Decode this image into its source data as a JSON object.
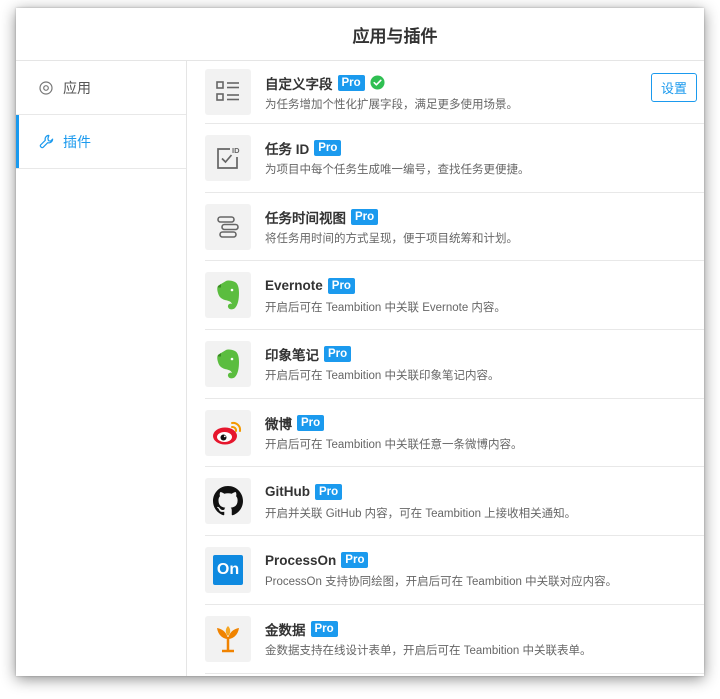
{
  "header": {
    "title": "应用与插件"
  },
  "sidebar": {
    "items": [
      {
        "label": "应用",
        "icon": "target-icon"
      },
      {
        "label": "插件",
        "icon": "wrench-icon"
      }
    ]
  },
  "colors": {
    "accent": "#1b9aee",
    "check": "#2fbf52",
    "evernote": "#5bbd3f"
  },
  "plugins": [
    {
      "name": "自定义字段",
      "badge": "Pro",
      "installed": true,
      "description": "为任务增加个性化扩展字段，满足更多使用场景。",
      "action_label": "设置",
      "icon": "custom-fields-icon"
    },
    {
      "name": "任务 ID",
      "badge": "Pro",
      "description": "为项目中每个任务生成唯一编号，查找任务更便捷。",
      "icon": "task-id-icon"
    },
    {
      "name": "任务时间视图",
      "badge": "Pro",
      "description": "将任务用时间的方式呈现，便于项目统筹和计划。",
      "icon": "timeline-icon"
    },
    {
      "name": "Evernote",
      "badge": "Pro",
      "description": "开启后可在 Teambition 中关联 Evernote 内容。",
      "icon": "evernote-icon"
    },
    {
      "name": "印象笔记",
      "badge": "Pro",
      "description": "开启后可在 Teambition 中关联印象笔记内容。",
      "icon": "yinxiang-icon"
    },
    {
      "name": "微博",
      "badge": "Pro",
      "description": "开启后可在 Teambition 中关联任意一条微博内容。",
      "icon": "weibo-icon"
    },
    {
      "name": "GitHub",
      "badge": "Pro",
      "description": "开启并关联 GitHub 内容，可在 Teambition 上接收相关通知。",
      "icon": "github-icon"
    },
    {
      "name": "ProcessOn",
      "badge": "Pro",
      "description": "ProcessOn 支持协同绘图，开启后可在 Teambition 中关联对应内容。",
      "icon": "processon-icon",
      "icon_text": "On"
    },
    {
      "name": "金数据",
      "badge": "Pro",
      "description": "金数据支持在线设计表单，开启后可在 Teambition 中关联表单。",
      "icon": "jinshuju-icon"
    }
  ]
}
